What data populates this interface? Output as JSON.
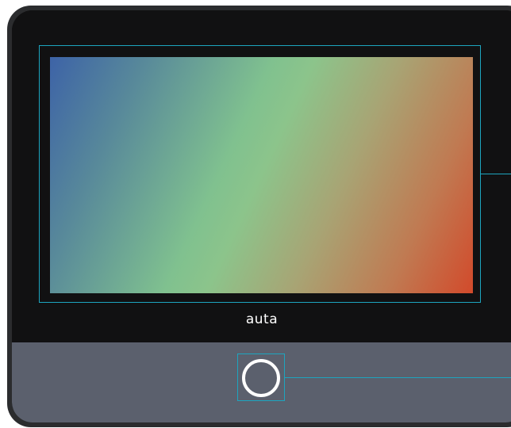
{
  "device": {
    "brand_label": "auta",
    "screen": {
      "gradient_colors": [
        "#3d63a7",
        "#80c18f",
        "#d24a2b"
      ]
    },
    "home_button": {
      "icon": "circle-ring-icon"
    },
    "colors": {
      "shell": "#2b2c2e",
      "bezel": "#111112",
      "base": "#5b606d",
      "callout_accent": "#1da5bf"
    }
  }
}
